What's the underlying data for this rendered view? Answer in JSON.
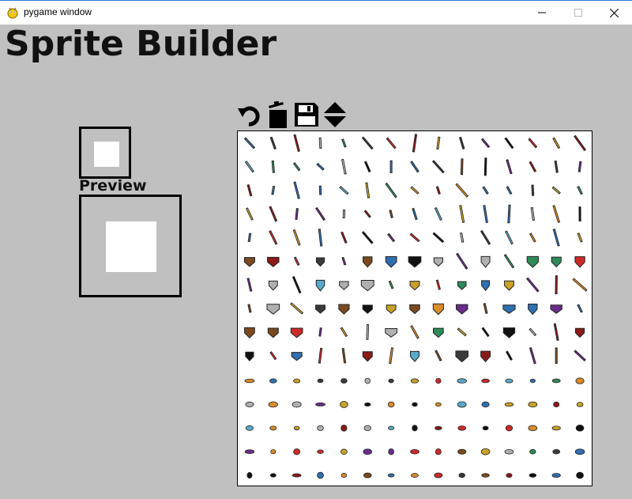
{
  "window": {
    "title": "pygame window",
    "icon": "pygame-snake-icon",
    "minimize_icon": "minimize-icon",
    "maximize_icon": "maximize-icon",
    "close_icon": "close-icon"
  },
  "app": {
    "title": "Sprite Builder",
    "preview_label": "Preview"
  },
  "toolbar": {
    "undo_icon": "undo-icon",
    "clear_icon": "trash-icon",
    "save_icon": "floppy-disk-icon",
    "toggle_icon": "up-down-arrows-icon"
  },
  "sprite_sheet": {
    "name": "item sprite sheet",
    "rows": 15,
    "columns": 15
  }
}
